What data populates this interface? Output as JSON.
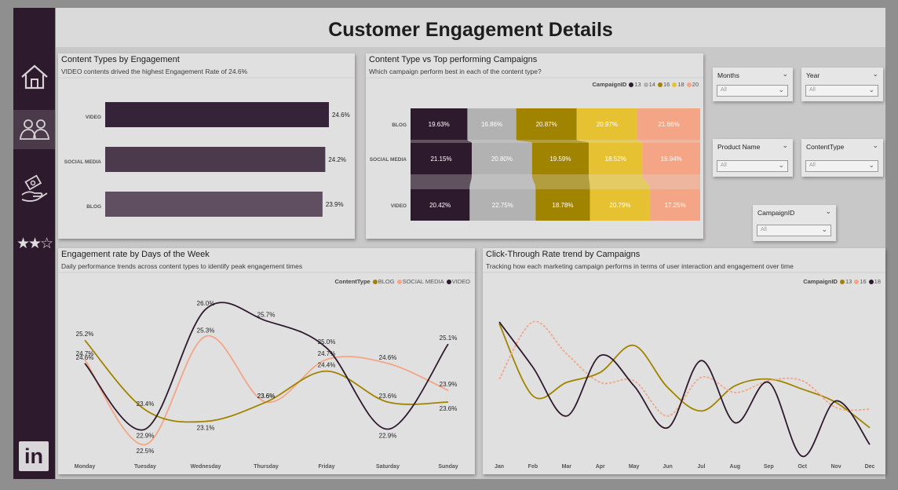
{
  "page_title": "Customer Engagement Details",
  "sidebar": {
    "items": [
      {
        "icon": "home-icon"
      },
      {
        "icon": "users-icon",
        "active": true
      },
      {
        "icon": "hand-money-icon"
      },
      {
        "icon": "star-rating-icon",
        "glyph": "★★☆"
      },
      {
        "icon": "linkedin-icon",
        "glyph": "in"
      }
    ]
  },
  "cards": {
    "content_types": {
      "title": "Content Types by Engagement",
      "subtitle": "VIDEO contents drived the highest Engagement Rate of 24.6%"
    },
    "content_vs_campaign": {
      "title": "Content Type vs Top performing Campaigns",
      "subtitle": "Which campaign perform best in each of the content type?"
    },
    "days": {
      "title": "Engagement rate by Days of the Week",
      "subtitle": "Daily performance trends across content types to identify peak engagement times"
    },
    "ctr": {
      "title": "Click-Through Rate trend by Campaigns",
      "subtitle": "Tracking how each marketing campaign performs in terms of user interaction and engagement over time"
    }
  },
  "slicers": [
    {
      "label": "Months",
      "value": "All"
    },
    {
      "label": "Year",
      "value": "All"
    },
    {
      "label": "Product Name",
      "value": "All"
    },
    {
      "label": "ContentType",
      "value": "All"
    },
    {
      "label": "CampaignID",
      "value": "All"
    }
  ],
  "chart_data": [
    {
      "type": "bar",
      "orientation": "horizontal",
      "title": "Content Types by Engagement",
      "categories": [
        "VIDEO",
        "SOCIAL MEDIA",
        "BLOG"
      ],
      "values": [
        24.6,
        24.2,
        23.9
      ],
      "value_labels": [
        "24.6%",
        "24.2%",
        "23.9%"
      ],
      "colors": [
        "#35233a",
        "#4a3a4c",
        "#5f4f60"
      ],
      "xlim": [
        0,
        24.6
      ]
    },
    {
      "type": "bar",
      "stacked": "100%",
      "orientation": "horizontal",
      "title": "Content Type vs Top performing Campaigns",
      "legend_title": "CampaignID",
      "legend_position": "top-right",
      "categories": [
        "BLOG",
        "SOCIAL MEDIA",
        "VIDEO"
      ],
      "series": [
        {
          "name": "13",
          "color": "#2e1a2d",
          "values": [
            19.63,
            21.15,
            20.42
          ],
          "labels": [
            "19.63%",
            "21.15%",
            "20.42%"
          ]
        },
        {
          "name": "14",
          "color": "#b2b2b2",
          "values": [
            16.86,
            20.8,
            22.75
          ],
          "labels": [
            "16.86%",
            "20.80%",
            "22.75%"
          ]
        },
        {
          "name": "16",
          "color": "#a08400",
          "values": [
            20.87,
            19.59,
            18.78
          ],
          "labels": [
            "20.87%",
            "19.59%",
            "18.78%"
          ]
        },
        {
          "name": "18",
          "color": "#e6c233",
          "values": [
            20.97,
            18.52,
            20.79
          ],
          "labels": [
            "20.97%",
            "18.52%",
            "20.79%"
          ]
        },
        {
          "name": "20",
          "color": "#f3a585",
          "values": [
            21.66,
            19.94,
            17.25
          ],
          "labels": [
            "21.66%",
            "19.94%",
            "17.25%"
          ]
        }
      ]
    },
    {
      "type": "line",
      "title": "Engagement rate by Days of the Week",
      "legend_title": "ContentType",
      "legend_position": "top-right",
      "categories": [
        "Monday",
        "Tuesday",
        "Wednesday",
        "Thursday",
        "Friday",
        "Saturday",
        "Sunday"
      ],
      "ylim": [
        22.2,
        26.3
      ],
      "series": [
        {
          "name": "BLOG",
          "color": "#a08400",
          "values": [
            25.2,
            23.4,
            23.1,
            23.6,
            24.4,
            23.6,
            23.6
          ],
          "labels": [
            "25.2%",
            "23.4%",
            "23.1%",
            "23.6%",
            "24.4%",
            "23.6%",
            "23.6%"
          ]
        },
        {
          "name": "SOCIAL MEDIA",
          "color": "#f3a585",
          "values": [
            24.7,
            22.5,
            25.3,
            23.6,
            24.7,
            24.6,
            23.9
          ],
          "labels": [
            "24.7%",
            "22.5%",
            "25.3%",
            "23.6%",
            "24.7%",
            "24.6%",
            "23.9%"
          ]
        },
        {
          "name": "VIDEO",
          "color": "#2e1a2d",
          "values": [
            24.6,
            22.9,
            26.0,
            25.7,
            25.0,
            22.9,
            25.1
          ],
          "labels": [
            "24.6%",
            "22.9%",
            "26.0%",
            "25.7%",
            "25.0%",
            "22.9%",
            "25.1%"
          ]
        }
      ]
    },
    {
      "type": "line",
      "title": "Click-Through Rate trend by Campaigns",
      "legend_title": "CampaignID",
      "legend_position": "top-right",
      "categories": [
        "Jan",
        "Feb",
        "Mar",
        "Apr",
        "May",
        "Jun",
        "Jul",
        "Aug",
        "Sep",
        "Oct",
        "Nov",
        "Dec"
      ],
      "ylim": [
        0,
        100
      ],
      "y_unlabeled": true,
      "series": [
        {
          "name": "13",
          "color": "#a08400",
          "dashed": false,
          "values": [
            85,
            42,
            50,
            56,
            72,
            47,
            33,
            48,
            52,
            46,
            38,
            23
          ]
        },
        {
          "name": "16",
          "color": "#f3a585",
          "dashed": true,
          "values": [
            52,
            86,
            67,
            50,
            51,
            30,
            53,
            44,
            51,
            51,
            35,
            34
          ]
        },
        {
          "name": "18",
          "color": "#2e1a2d",
          "dashed": false,
          "values": [
            86,
            59,
            30,
            66,
            48,
            23,
            63,
            26,
            50,
            6,
            39,
            13
          ]
        }
      ]
    }
  ]
}
